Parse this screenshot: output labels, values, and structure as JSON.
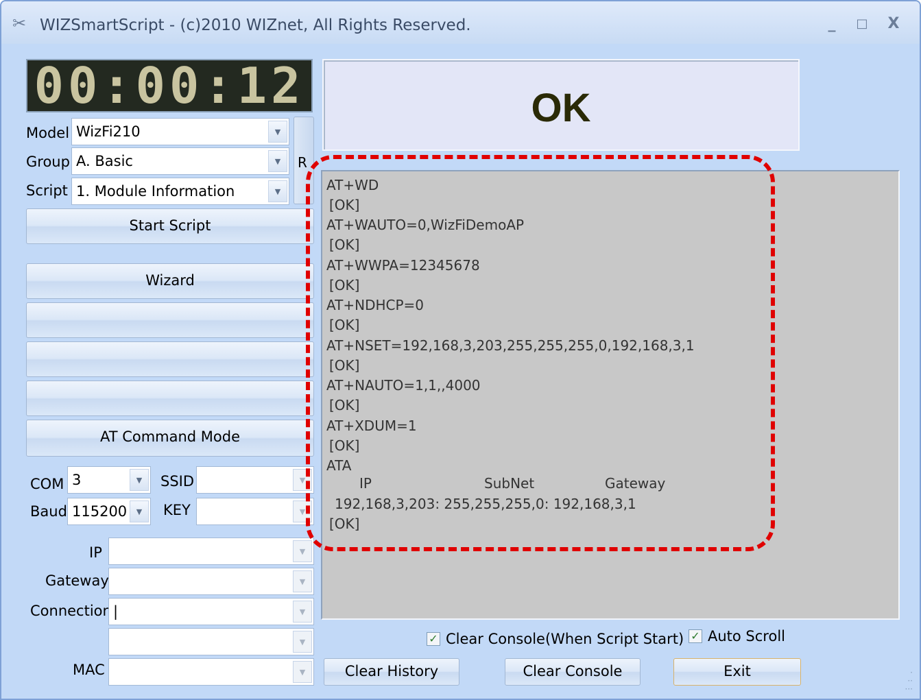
{
  "window": {
    "title": "WIZSmartScript - (c)2010 WIZnet, All Rights Reserved.",
    "app_icon": "tools-icon",
    "controls": {
      "minimize": "_",
      "maximize": "□",
      "close": "X"
    }
  },
  "timer": {
    "display": "00:00:12"
  },
  "model": {
    "label": "Model",
    "value": "WizFi210"
  },
  "group": {
    "label": "Group",
    "value": "A. Basic"
  },
  "script": {
    "label": "Script",
    "value": "1. Module Information"
  },
  "side_button": {
    "label": "R"
  },
  "buttons": {
    "start_script": "Start Script",
    "wizard": "Wizard",
    "blank1": "",
    "blank2": "",
    "blank3": "",
    "at_command_mode": "AT Command Mode",
    "clear_history": "Clear History",
    "clear_console": "Clear Console",
    "exit": "Exit"
  },
  "com": {
    "label": "COM",
    "value": "3"
  },
  "baud": {
    "label": "Baud",
    "value": "115200"
  },
  "ssid": {
    "label": "SSID",
    "value": ""
  },
  "key": {
    "label": "KEY",
    "value": ""
  },
  "ip": {
    "label": "IP",
    "value": ""
  },
  "gateway": {
    "label": "Gateway",
    "value": ""
  },
  "connection": {
    "label": "Connection",
    "value": "|"
  },
  "extra": {
    "value": ""
  },
  "mac": {
    "label": "MAC",
    "value": ""
  },
  "status": {
    "text": "OK"
  },
  "console": {
    "lines": [
      "AT+WD",
      "[OK]",
      "AT+WAUTO=0,WizFiDemoAP",
      "[OK]",
      "AT+WWPA=12345678",
      "[OK]",
      "AT+NDHCP=0",
      "[OK]",
      "AT+NSET=192,168,3,203,255,255,255,0,192,168,3,1",
      "[OK]",
      "AT+NAUTO=1,1,,4000",
      "[OK]",
      "AT+XDUM=1",
      "[OK]",
      "ATA"
    ],
    "table_header": {
      "ip": "IP",
      "subnet": "SubNet",
      "gateway": "Gateway"
    },
    "table_row": "192,168,3,203:  255,255,255,0:  192,168,3,1",
    "final": "[OK]"
  },
  "options": {
    "clear_console": {
      "label": "Clear Console(When Script Start)",
      "checked": true
    },
    "auto_scroll": {
      "label": "Auto Scroll",
      "checked": true
    }
  },
  "colors": {
    "window_bg": "#c2d9f7",
    "lcd_bg": "#232920",
    "status_bg": "#e3e6f7",
    "console_bg": "#c8c8c8",
    "highlight": "#e00000"
  }
}
